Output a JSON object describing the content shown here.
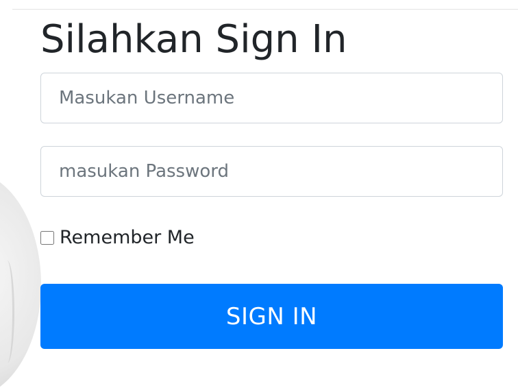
{
  "form": {
    "title": "Silahkan Sign In",
    "username": {
      "placeholder": "Masukan Username",
      "value": ""
    },
    "password": {
      "placeholder": "masukan Password",
      "value": ""
    },
    "remember": {
      "label": "Remember Me",
      "checked": false
    },
    "submit_label": "SIGN IN"
  },
  "colors": {
    "accent": "#007bff",
    "text": "#212529",
    "placeholder": "#6c757d",
    "border": "#ced4da"
  }
}
